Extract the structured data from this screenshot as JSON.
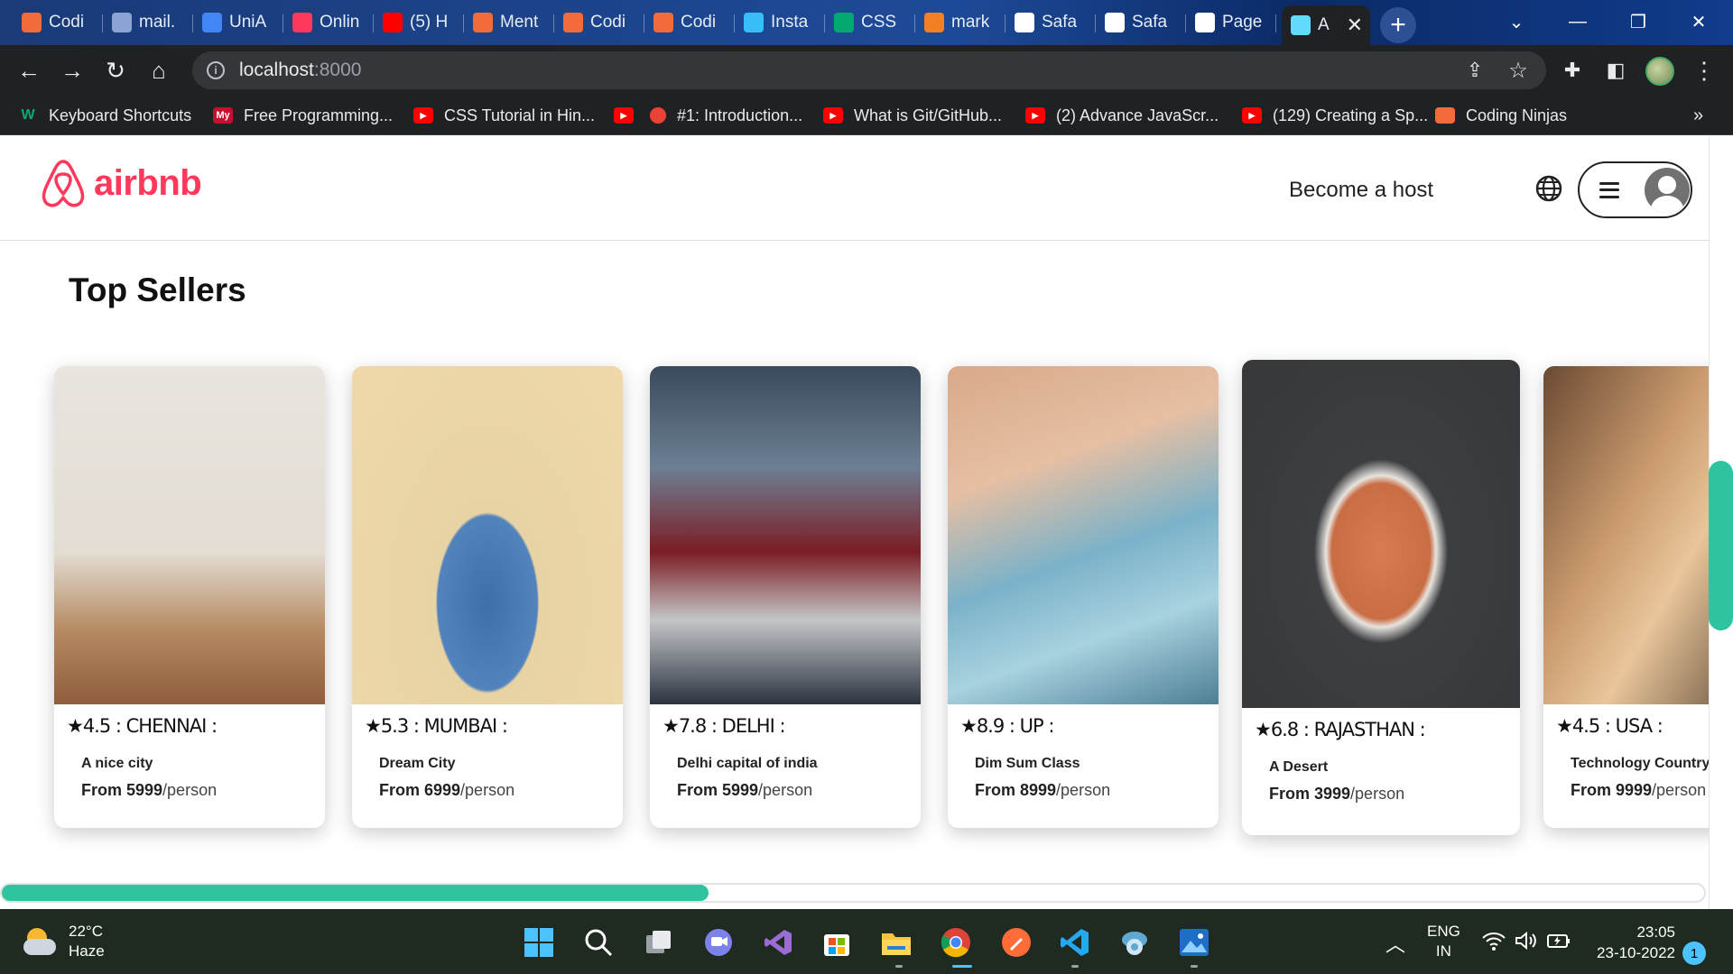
{
  "browser": {
    "tabs": [
      {
        "label": "Codi",
        "icon": "coding-ninjas-icon",
        "color": "#f26b3a"
      },
      {
        "label": "mail.",
        "icon": "globe-icon",
        "color": "#8aa4d6"
      },
      {
        "label": "UniA",
        "icon": "docs-icon",
        "color": "#4285f4"
      },
      {
        "label": "Onlin",
        "icon": "airbnb-icon",
        "color": "#ff385c"
      },
      {
        "label": "(5) H",
        "icon": "youtube-icon",
        "color": "#ff0000"
      },
      {
        "label": "Ment",
        "icon": "coding-ninjas-icon",
        "color": "#f26b3a"
      },
      {
        "label": "Codi",
        "icon": "coding-ninjas-icon",
        "color": "#f26b3a"
      },
      {
        "label": "Codi",
        "icon": "coding-ninjas-icon",
        "color": "#f26b3a"
      },
      {
        "label": "Insta",
        "icon": "tailwind-icon",
        "color": "#38bdf8"
      },
      {
        "label": "CSS",
        "icon": "w3-icon",
        "color": "#04aa6d"
      },
      {
        "label": "mark",
        "icon": "stackoverflow-icon",
        "color": "#f48024"
      },
      {
        "label": "Safa",
        "icon": "github-icon",
        "color": "#ffffff"
      },
      {
        "label": "Safa",
        "icon": "github-icon",
        "color": "#ffffff"
      },
      {
        "label": "Page",
        "icon": "github-icon",
        "color": "#ffffff"
      },
      {
        "label": "A",
        "icon": "react-icon",
        "color": "#61dafb"
      }
    ],
    "url_host": "localhost",
    "url_port": ":8000",
    "bookmarks": [
      {
        "label": "Keyboard Shortcuts",
        "icon": "w3-icon"
      },
      {
        "label": "Free Programming...",
        "icon": "my-icon"
      },
      {
        "label": "CSS Tutorial in Hin...",
        "icon": "youtube-icon"
      },
      {
        "label": "",
        "icon": "youtube-icon"
      },
      {
        "label": "#1: Introduction...",
        "icon": "record-icon"
      },
      {
        "label": "What is Git/GitHub...",
        "icon": "youtube-icon"
      },
      {
        "label": "(2) Advance JavaScr...",
        "icon": "youtube-icon"
      },
      {
        "label": "(129) Creating a Sp...",
        "icon": "youtube-icon"
      },
      {
        "label": "Coding Ninjas",
        "icon": "coding-ninjas-icon"
      }
    ],
    "bookmarks_more": "»"
  },
  "header": {
    "logo_text": "airbnb",
    "become_host": "Become a host"
  },
  "section_title": "Top Sellers",
  "cards": [
    {
      "rating": "★4.5 : CHENNAI :",
      "desc": "A nice city",
      "price_prefix": "From 5999",
      "price_unit": "/person",
      "image": "woman-in-mirror-room"
    },
    {
      "rating": "★5.3 : MUMBAI :",
      "desc": "Dream City",
      "price_prefix": "From 6999",
      "price_unit": "/person",
      "image": "woman-with-camera-lens"
    },
    {
      "rating": "★7.8 : DELHI :",
      "desc": "Delhi capital of india",
      "price_prefix": "From 5999",
      "price_unit": "/person",
      "image": "man-with-binoculars"
    },
    {
      "rating": "★8.9 : UP :",
      "desc": "Dim Sum Class",
      "price_prefix": "From 8999",
      "price_unit": "/person",
      "image": "face-reflection-mirror"
    },
    {
      "rating": "★6.8 : RAJASTHAN :",
      "desc": "A Desert",
      "price_prefix": "From 3999",
      "price_unit": "/person",
      "image": "mirror-on-asphalt"
    },
    {
      "rating": "★4.5 : USA :",
      "desc": "Technology Country",
      "price_prefix": "From 9999",
      "price_unit": "/person",
      "image": "woman-applying-makeup"
    }
  ],
  "scroll": {
    "horizontal_fraction": 0.415,
    "vertical_start_fraction": 0.42,
    "vertical_size_fraction": 0.22
  },
  "taskbar": {
    "temperature": "22°C",
    "weather": "Haze",
    "language_top": "ENG",
    "language_bottom": "IN",
    "time": "23:05",
    "date": "23-10-2022",
    "notifications": "1"
  },
  "colors": {
    "brand": "#ff385c",
    "accent": "#2ec4a0"
  }
}
